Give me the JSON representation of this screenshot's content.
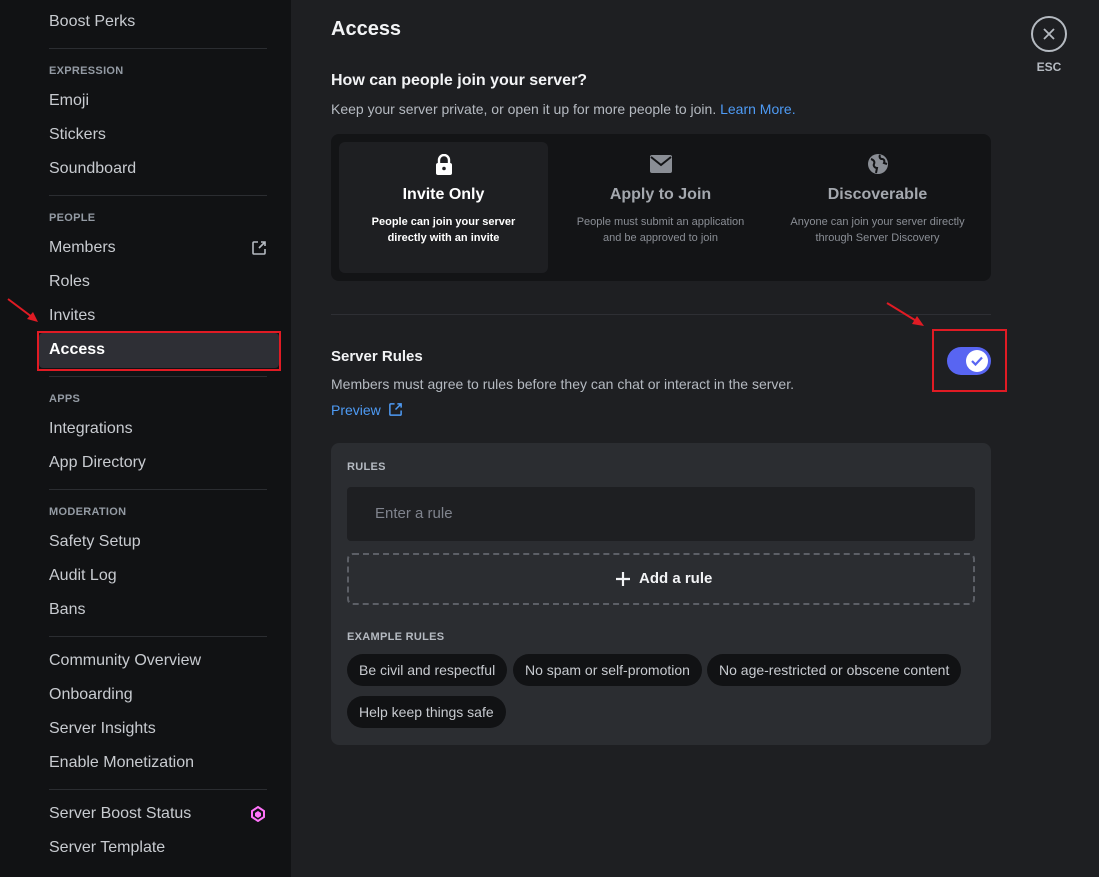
{
  "sidebar": {
    "top_item": "Boost Perks",
    "sections": {
      "expression": "EXPRESSION",
      "people": "PEOPLE",
      "apps": "APPS",
      "moderation": "MODERATION"
    },
    "items": {
      "emoji": "Emoji",
      "stickers": "Stickers",
      "soundboard": "Soundboard",
      "members": "Members",
      "roles": "Roles",
      "invites": "Invites",
      "access": "Access",
      "integrations": "Integrations",
      "app_directory": "App Directory",
      "safety_setup": "Safety Setup",
      "audit_log": "Audit Log",
      "bans": "Bans",
      "community_overview": "Community Overview",
      "onboarding": "Onboarding",
      "server_insights": "Server Insights",
      "enable_monetization": "Enable Monetization",
      "server_boost_status": "Server Boost Status",
      "server_template": "Server Template"
    }
  },
  "main": {
    "title": "Access",
    "join_heading": "How can people join your server?",
    "join_desc": "Keep your server private, or open it up for more people to join.",
    "learn_more": "Learn More.",
    "options": [
      {
        "title": "Invite Only",
        "desc": "People can join your server directly with an invite",
        "icon": "lock-icon"
      },
      {
        "title": "Apply to Join",
        "desc": "People must submit an application and be approved to join",
        "icon": "mail-icon"
      },
      {
        "title": "Discoverable",
        "desc": "Anyone can join your server directly through Server Discovery",
        "icon": "globe-icon"
      }
    ],
    "rules_title": "Server Rules",
    "rules_desc": "Members must agree to rules before they can chat or interact in the server.",
    "preview_label": "Preview",
    "rules_toggle_on": true,
    "rules_header": "RULES",
    "rule_placeholder": "Enter a rule",
    "add_rule": "Add a rule",
    "example_header": "EXAMPLE RULES",
    "example_rules": [
      "Be civil and respectful",
      "No spam or self-promotion",
      "No age-restricted or obscene content",
      "Help keep things safe"
    ],
    "esc_label": "ESC"
  },
  "colors": {
    "accent": "#5865f2",
    "link": "#4e9bf5",
    "highlight": "#e01b24",
    "boost": "#ff73fa"
  }
}
